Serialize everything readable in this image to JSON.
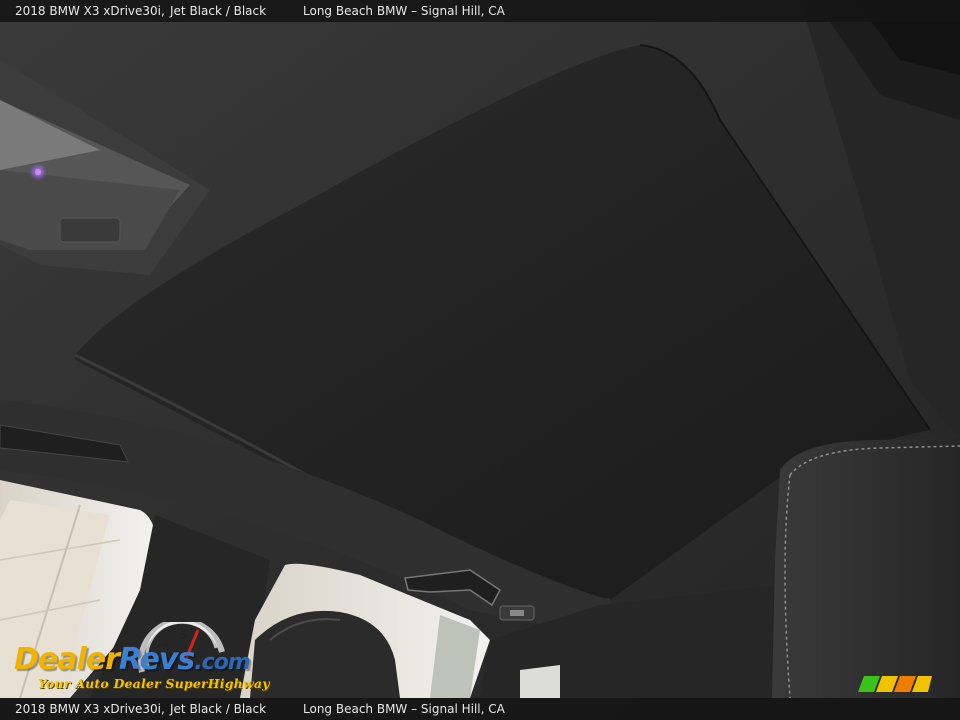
{
  "caption": {
    "model": "2018 BMW X3 xDrive30i,",
    "color": "Jet Black  /  Black",
    "dealer": "Long Beach BMW – Signal Hill, CA"
  },
  "watermark": {
    "brand_dealer": "Dealer",
    "brand_revs": "Revs",
    "brand_tld": ".com",
    "slogan": "Your Auto Dealer SuperHighway"
  },
  "scene": {
    "subject": "panoramic-sunroof-shade",
    "colors": {
      "headliner": "#2b2b2b",
      "shade": "#1e1e1e",
      "window_light": "#e9e9e7",
      "seat_leather": "#2a2a2a",
      "seat_stitch": "#8f8f8f",
      "ambient_purple": "#9b59ff"
    }
  }
}
